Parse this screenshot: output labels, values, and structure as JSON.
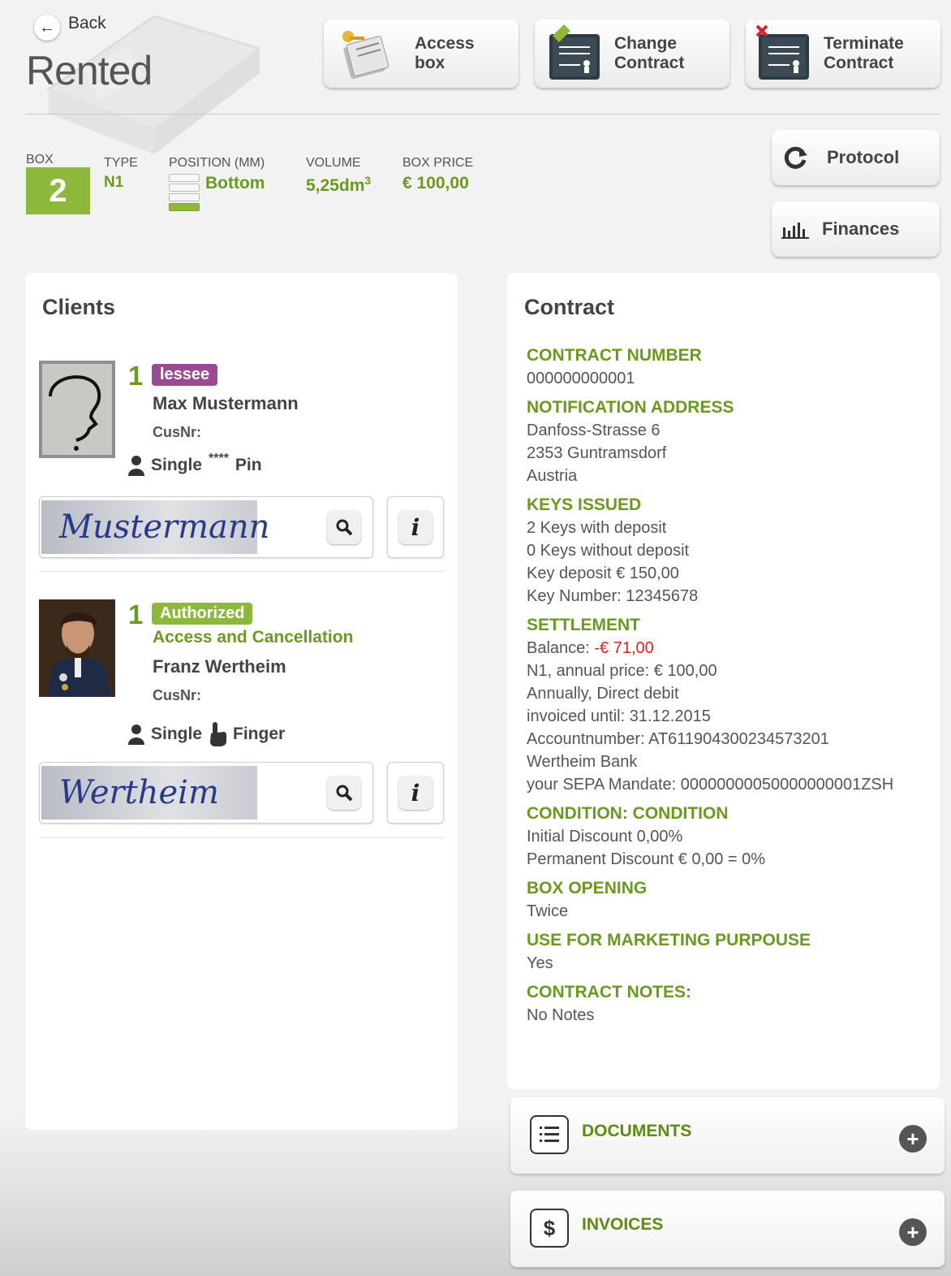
{
  "header": {
    "back_label": "Back",
    "title": "Rented",
    "buttons": [
      {
        "label": "Access\nbox",
        "icon": "keys-notebook-icon"
      },
      {
        "label": "Change\nContract",
        "icon": "contract-edit-icon"
      },
      {
        "label": "Terminate\nContract",
        "icon": "contract-terminate-icon"
      }
    ]
  },
  "box_info": {
    "box_label": "BOX",
    "box_number": "2",
    "type_label": "TYPE",
    "type_value": "N1",
    "position_label": "POSITION (MM)",
    "position_value": "Bottom",
    "volume_label": "VOLUME",
    "volume_value": "5,25dm",
    "volume_sup": "3",
    "price_label": "BOX PRICE",
    "price_value": "€ 100,00"
  },
  "side_buttons": {
    "protocol": "Protocol",
    "finances": "Finances"
  },
  "clients": {
    "title": "Clients",
    "list": [
      {
        "number": "1",
        "role": "lessee",
        "role_color": "#9b4a94",
        "subtitle": "",
        "name": "Max Mustermann",
        "cusnr": "CusNr:",
        "access": "Single",
        "auth_symbol": "****",
        "auth": "Pin",
        "signature": "Mustermann"
      },
      {
        "number": "1",
        "role": "Authorized",
        "role_color": "#8db83c",
        "subtitle": "Access and Cancellation",
        "name": "Franz Wertheim",
        "cusnr": "CusNr:",
        "access": "Single",
        "auth": "Finger",
        "signature": "Wertheim"
      }
    ]
  },
  "contract": {
    "title": "Contract",
    "sections": [
      {
        "heading": "CONTRACT NUMBER",
        "lines": [
          "000000000001"
        ]
      },
      {
        "heading": "NOTIFICATION ADDRESS",
        "lines": [
          "Danfoss-Strasse 6",
          "2353 Guntramsdorf",
          "Austria"
        ]
      },
      {
        "heading": "KEYS ISSUED",
        "lines": [
          "2 Keys with deposit",
          "0 Keys without deposit",
          "Key deposit € 150,00",
          "Key Number: 12345678"
        ]
      },
      {
        "heading": "SETTLEMENT",
        "balance_label": "Balance: ",
        "balance_value": "-€ 71,00",
        "lines": [
          "N1, annual price: € 100,00",
          "Annually, Direct debit",
          "invoiced until: 31.12.2015",
          "Accountnumber: AT611904300234573201",
          "Wertheim Bank",
          "your SEPA Mandate: 00000000050000000001ZSH"
        ]
      },
      {
        "heading": "CONDITION: CONDITION",
        "lines": [
          "Initial Discount 0,00%",
          "Permanent Discount € 0,00 = 0%"
        ]
      },
      {
        "heading": "BOX OPENING",
        "lines": [
          "Twice"
        ]
      },
      {
        "heading": "USE FOR MARKETING PURPOUSE",
        "lines": [
          "Yes"
        ]
      },
      {
        "heading": "CONTRACT NOTES:",
        "lines": [
          "No Notes"
        ]
      }
    ]
  },
  "accordions": {
    "documents": "DOCUMENTS",
    "invoices": "INVOICES"
  },
  "colors": {
    "accent_green": "#6a9a1f",
    "badge_green": "#8db83c",
    "lessee_purple": "#9b4a94",
    "negative_red": "#dd2222"
  }
}
